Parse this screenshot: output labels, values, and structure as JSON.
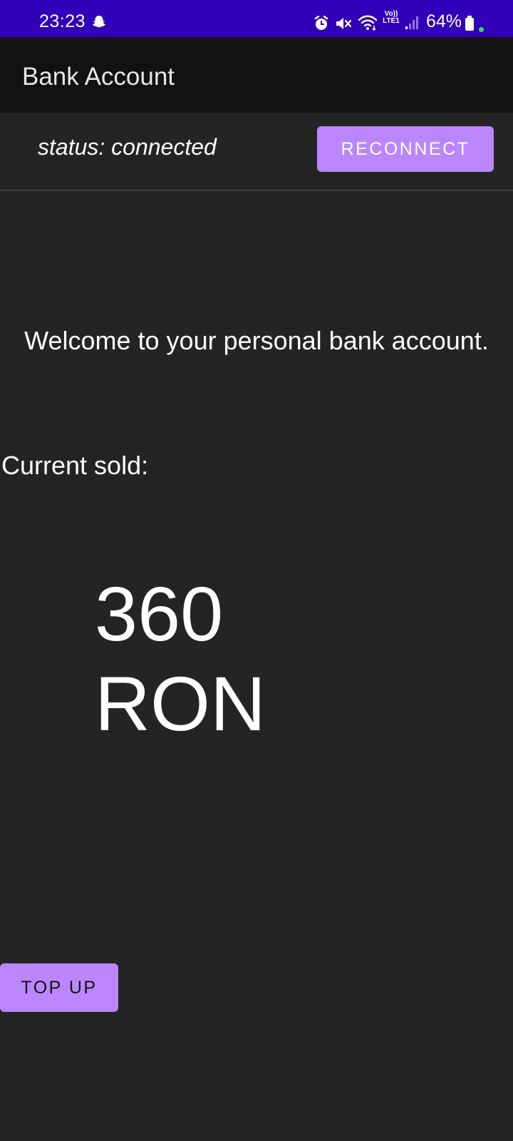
{
  "status_bar": {
    "time": "23:23",
    "volte_line1": "Vo))",
    "volte_line2": "LTE1",
    "battery_percent": "64%",
    "icons": [
      "snapchat-icon",
      "alarm-icon",
      "mute-icon",
      "wifi-icon",
      "volte-icon",
      "signal-icon",
      "battery-icon"
    ]
  },
  "app_bar": {
    "title": "Bank Account"
  },
  "connection": {
    "status": "status: connected",
    "reconnect_label": "RECONNECT"
  },
  "main": {
    "welcome": "Welcome to your personal bank account.",
    "sold_label": "Current sold:",
    "amount": "360",
    "currency": "RON",
    "topup_label": "TOP UP"
  },
  "colors": {
    "status_bar": "#3100b8",
    "app_bar": "#121212",
    "background": "#242424",
    "accent": "#bb86fc"
  }
}
